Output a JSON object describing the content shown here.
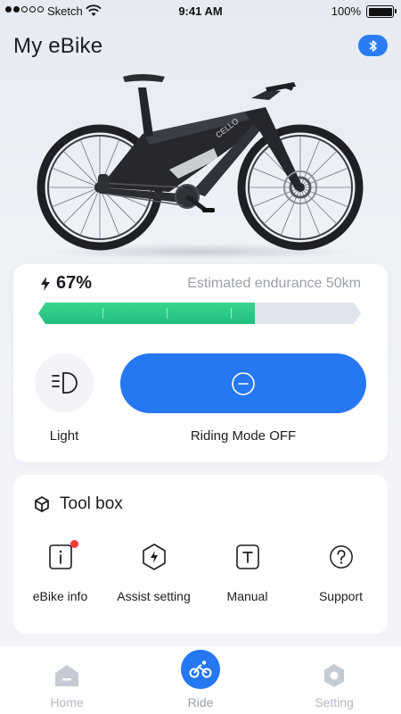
{
  "status_bar": {
    "carrier": "Sketch",
    "time": "9:41 AM",
    "battery": "100%",
    "signal_bars": 5,
    "signal_filled": 2
  },
  "header": {
    "title": "My eBike",
    "bluetooth_icon": "bluetooth-icon"
  },
  "bike": {
    "image_icon": "ebike-image",
    "frame_text": "CELLO"
  },
  "status": {
    "battery_level": "67%",
    "battery_fraction": 0.67,
    "endurance_text": "Estimated endurance 50km",
    "charge_icon": "lightning-icon"
  },
  "controls": {
    "light_label": "Light",
    "light_icon": "headlight-icon",
    "ride_mode_label": "Riding Mode OFF",
    "ride_mode_icon": "minus-circle-icon"
  },
  "toolbox": {
    "title": "Tool box",
    "title_icon": "box-icon",
    "items": [
      {
        "label": "eBike info",
        "icon": "info-icon",
        "badge": true
      },
      {
        "label": "Assist setting",
        "icon": "assist-bolt-icon",
        "badge": false
      },
      {
        "label": "Manual",
        "icon": "manual-icon",
        "badge": false
      },
      {
        "label": "Support",
        "icon": "help-icon",
        "badge": false
      }
    ]
  },
  "tabs": [
    {
      "label": "Home",
      "icon": "home-icon",
      "active": false
    },
    {
      "label": "Ride",
      "icon": "bike-icon",
      "active": true
    },
    {
      "label": "Setting",
      "icon": "settings-icon",
      "active": false
    }
  ],
  "colors": {
    "accent": "#2577f2",
    "battery_fill": "#2ccb87",
    "badge": "#f23a3a",
    "muted_text": "#9aa0a8"
  }
}
